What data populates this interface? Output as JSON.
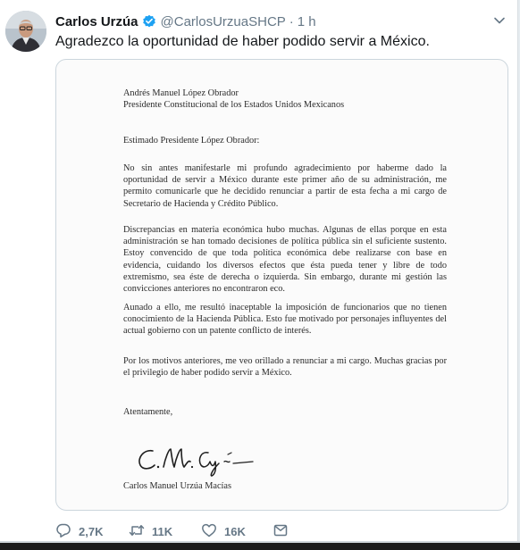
{
  "user": {
    "display_name": "Carlos Urzúa",
    "handle": "@CarlosUrzuaSHCP",
    "separator": "·",
    "time": "1 h"
  },
  "tweet_text": "Agradezco la oportunidad de haber podido servir a México.",
  "letter": {
    "addressee_line1": "Andrés Manuel López Obrador",
    "addressee_line2": "Presidente Constitucional de los Estados Unidos Mexicanos",
    "salutation": "Estimado Presidente López Obrador:",
    "paragraph1": "No sin antes manifestarle mi profundo agradecimiento por haberme dado la oportunidad de servir a México durante este primer año de su administración, me permito comunicarle que he decidido renunciar a partir de esta fecha a mi cargo de Secretario de Hacienda y Crédito Público.",
    "paragraph2": "Discrepancias en materia económica hubo muchas. Algunas de ellas porque en esta administración se han tomado decisiones de política pública sin el suficiente sustento. Estoy convencido de que toda política económica debe realizarse con base en evidencia, cuidando los diversos efectos que ésta pueda tener y libre de todo extremismo, sea éste de derecha o izquierda. Sin embargo, durante mi gestión las convicciones anteriores no encontraron eco.",
    "paragraph3": "Aunado a ello, me resultó inaceptable la imposición de funcionarios que no tienen conocimiento de la Hacienda Pública. Esto fue motivado por personajes influyentes del actual gobierno con un patente conflicto de interés.",
    "paragraph4": "Por los motivos anteriores, me veo orillado a renunciar a mi cargo. Muchas gracias por el privilegio de haber podido servir a México.",
    "closing": "Atentamente,",
    "signer": "Carlos Manuel Urzúa Macías"
  },
  "actions": {
    "replies": "2,7K",
    "retweets": "11K",
    "likes": "16K"
  },
  "colors": {
    "verified": "#1da1f2",
    "meta_text": "#657786",
    "border": "#ccd6dd"
  },
  "icons": [
    "verified-badge-icon",
    "caret-down-icon",
    "reply-icon",
    "retweet-icon",
    "like-icon",
    "direct-message-icon"
  ]
}
